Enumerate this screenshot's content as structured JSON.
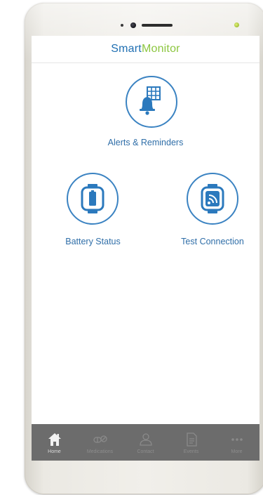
{
  "app": {
    "logo_part_1": "Smart",
    "logo_part_2": "Monitor"
  },
  "features": [
    {
      "label": "Alerts & Reminders",
      "icon": "bell-calendar-icon"
    },
    {
      "label": "Battery Status",
      "icon": "battery-icon"
    },
    {
      "label": "Test Connection",
      "icon": "wireless-signal-icon"
    }
  ],
  "bottom_nav": {
    "active": "Home",
    "items": [
      {
        "label": "Home",
        "icon": "home-icon"
      },
      {
        "label": "Medications",
        "icon": "pills-icon"
      },
      {
        "label": "Contact",
        "icon": "person-icon"
      },
      {
        "label": "Events",
        "icon": "document-icon"
      },
      {
        "label": "More",
        "icon": "more-dots-icon"
      }
    ]
  },
  "colors": {
    "brand_blue": "#1f6fb2",
    "brand_green": "#8cc63f",
    "icon_blue": "#3b83c2",
    "nav_background": "#6c6c6c"
  }
}
